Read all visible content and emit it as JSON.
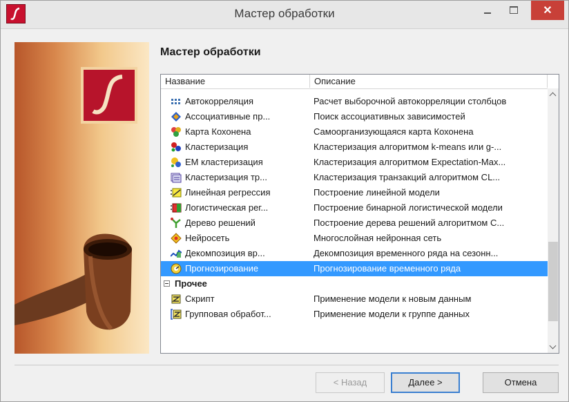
{
  "window": {
    "title": "Мастер обработки",
    "close_glyph": "✕"
  },
  "heading": "Мастер обработки",
  "list": {
    "columns": [
      "Название",
      "Описание"
    ],
    "rows": [
      {
        "name": "Автокорреляция",
        "desc": "Расчет выборочной автокорреляции столбцов",
        "icon": "autocorrelation-icon"
      },
      {
        "name": "Ассоциативные пр...",
        "desc": "Поиск ассоциативных зависимостей",
        "icon": "association-icon"
      },
      {
        "name": "Карта Кохонена",
        "desc": "Самоорганизующаяся карта Кохонена",
        "icon": "kohonen-map-icon"
      },
      {
        "name": "Кластеризация",
        "desc": "Кластеризация алгоритмом k-means или g-...",
        "icon": "clustering-icon"
      },
      {
        "name": "EM кластеризация",
        "desc": "Кластеризация алгоритмом Expectation-Max...",
        "icon": "em-clustering-icon"
      },
      {
        "name": "Кластеризация тр...",
        "desc": "Кластеризация транзакций алгоритмом CL...",
        "icon": "transaction-clustering-icon"
      },
      {
        "name": "Линейная регрессия",
        "desc": "Построение линейной модели",
        "icon": "linear-regression-icon"
      },
      {
        "name": "Логистическая рег...",
        "desc": "Построение бинарной логистической модели",
        "icon": "logistic-regression-icon"
      },
      {
        "name": "Дерево решений",
        "desc": "Построение дерева решений алгоритмом C...",
        "icon": "decision-tree-icon"
      },
      {
        "name": "Нейросеть",
        "desc": "Многослойная нейронная сеть",
        "icon": "neural-network-icon"
      },
      {
        "name": "Декомпозиция вр...",
        "desc": "Декомпозиция временного ряда на сезонн...",
        "icon": "decomposition-icon"
      },
      {
        "name": "Прогнозирование",
        "desc": "Прогнозирование временного ряда",
        "icon": "forecasting-icon",
        "selected": true
      }
    ],
    "group": {
      "name": "Прочее",
      "expander": "minus-expander"
    },
    "group_rows": [
      {
        "name": "Скрипт",
        "desc": "Применение модели к новым данным",
        "icon": "script-icon"
      },
      {
        "name": "Групповая обработ...",
        "desc": "Применение модели к группе данных",
        "icon": "batch-processing-icon"
      }
    ]
  },
  "buttons": {
    "back": "< Назад",
    "next": "Далее >",
    "cancel": "Отмена"
  },
  "colors": {
    "selection": "#3399ff",
    "close_button": "#c84038",
    "logo": "#b7142b"
  }
}
